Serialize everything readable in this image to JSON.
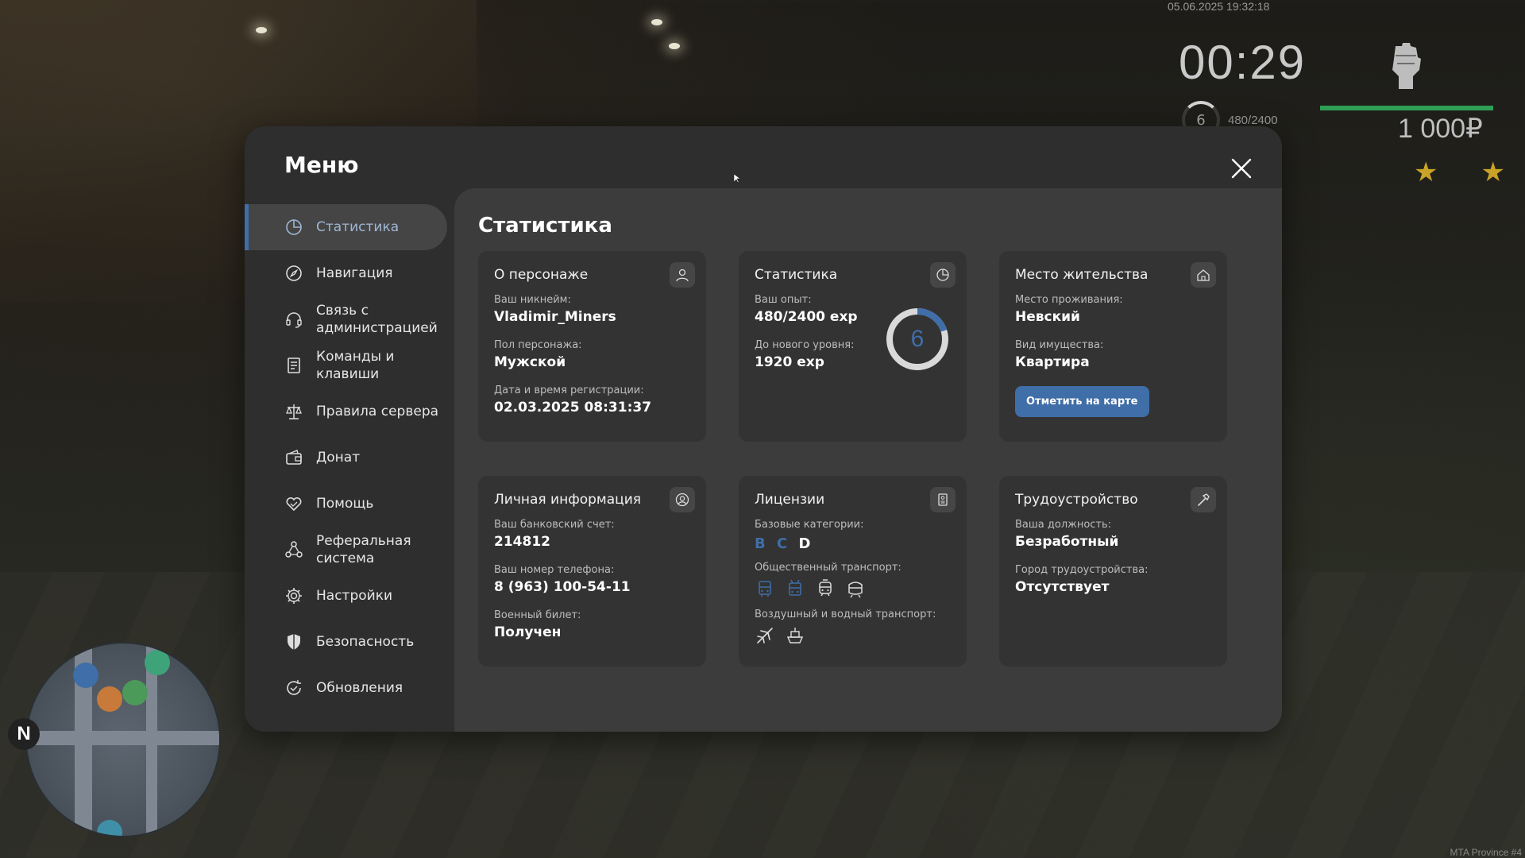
{
  "hud": {
    "datetime": "05.06.2025 19:32:18",
    "timer": "00:29",
    "level": "6",
    "exp": "480/2400",
    "money": "1 000₽",
    "stars": "★★",
    "brand": "MTA Province #4",
    "health_fraction": 1.0,
    "minimap_north": "N"
  },
  "menu": {
    "title": "Меню",
    "sidebar": [
      {
        "label": "Статистика",
        "icon": "stats-icon",
        "active": true
      },
      {
        "label": "Навигация",
        "icon": "compass-icon",
        "active": false
      },
      {
        "label": "Связь с администрацией",
        "icon": "headset-icon",
        "active": false
      },
      {
        "label": "Команды и клавиши",
        "icon": "document-icon",
        "active": false
      },
      {
        "label": "Правила сервера",
        "icon": "scales-icon",
        "active": false
      },
      {
        "label": "Донат",
        "icon": "wallet-icon",
        "active": false
      },
      {
        "label": "Помощь",
        "icon": "handshake-heart-icon",
        "active": false
      },
      {
        "label": "Реферальная система",
        "icon": "referral-icon",
        "active": false
      },
      {
        "label": "Настройки",
        "icon": "gear-icon",
        "active": false
      },
      {
        "label": "Безопасность",
        "icon": "shield-icon",
        "active": false
      },
      {
        "label": "Обновления",
        "icon": "refresh-check-icon",
        "active": false
      }
    ],
    "content_title": "Статистика",
    "cards": {
      "character": {
        "title": "О персонаже",
        "nickname_label": "Ваш никнейм:",
        "nickname": "Vladimir_Miners",
        "gender_label": "Пол персонажа:",
        "gender": "Мужской",
        "reg_label": "Дата и время регистрации:",
        "reg": "02.03.2025 08:31:37"
      },
      "stats": {
        "title": "Статистика",
        "exp_label": "Ваш опыт:",
        "exp": "480/2400 exp",
        "next_label": "До нового уровня:",
        "next": "1920 exp",
        "level": "6",
        "progress": 0.2
      },
      "residence": {
        "title": "Место жительства",
        "place_label": "Место проживания:",
        "place": "Невский",
        "property_label": "Вид имущества:",
        "property": "Квартира",
        "button": "Отметить на карте"
      },
      "personal": {
        "title": "Личная информация",
        "bank_label": "Ваш банковский счет:",
        "bank": "214812",
        "phone_label": "Ваш номер телефона:",
        "phone": "8 (963) 100-54-11",
        "military_label": "Военный билет:",
        "military": "Получен"
      },
      "licenses": {
        "title": "Лицензии",
        "base_label": "Базовые категории:",
        "categories": [
          {
            "letter": "B",
            "color": "#3f6ea8"
          },
          {
            "letter": "C",
            "color": "#3f6ea8"
          },
          {
            "letter": "D",
            "color": "#ffffff"
          }
        ],
        "public_label": "Общественный транспорт:",
        "public_icons": [
          "bus-icon",
          "trolleybus-icon",
          "tram-icon",
          "metro-icon"
        ],
        "air_label": "Воздушный и водный транспорт:",
        "air_icons": [
          "airplane-icon",
          "ship-icon"
        ]
      },
      "employment": {
        "title": "Трудоустройство",
        "position_label": "Ваша должность:",
        "position": "Безработный",
        "city_label": "Город трудоустройства:",
        "city": "Отсутствует"
      }
    }
  },
  "colors": {
    "accent": "#3f6ea8",
    "panel": "#2e2e2e",
    "content": "#3c3c3c",
    "card": "#333333",
    "health": "#2f9e55"
  }
}
